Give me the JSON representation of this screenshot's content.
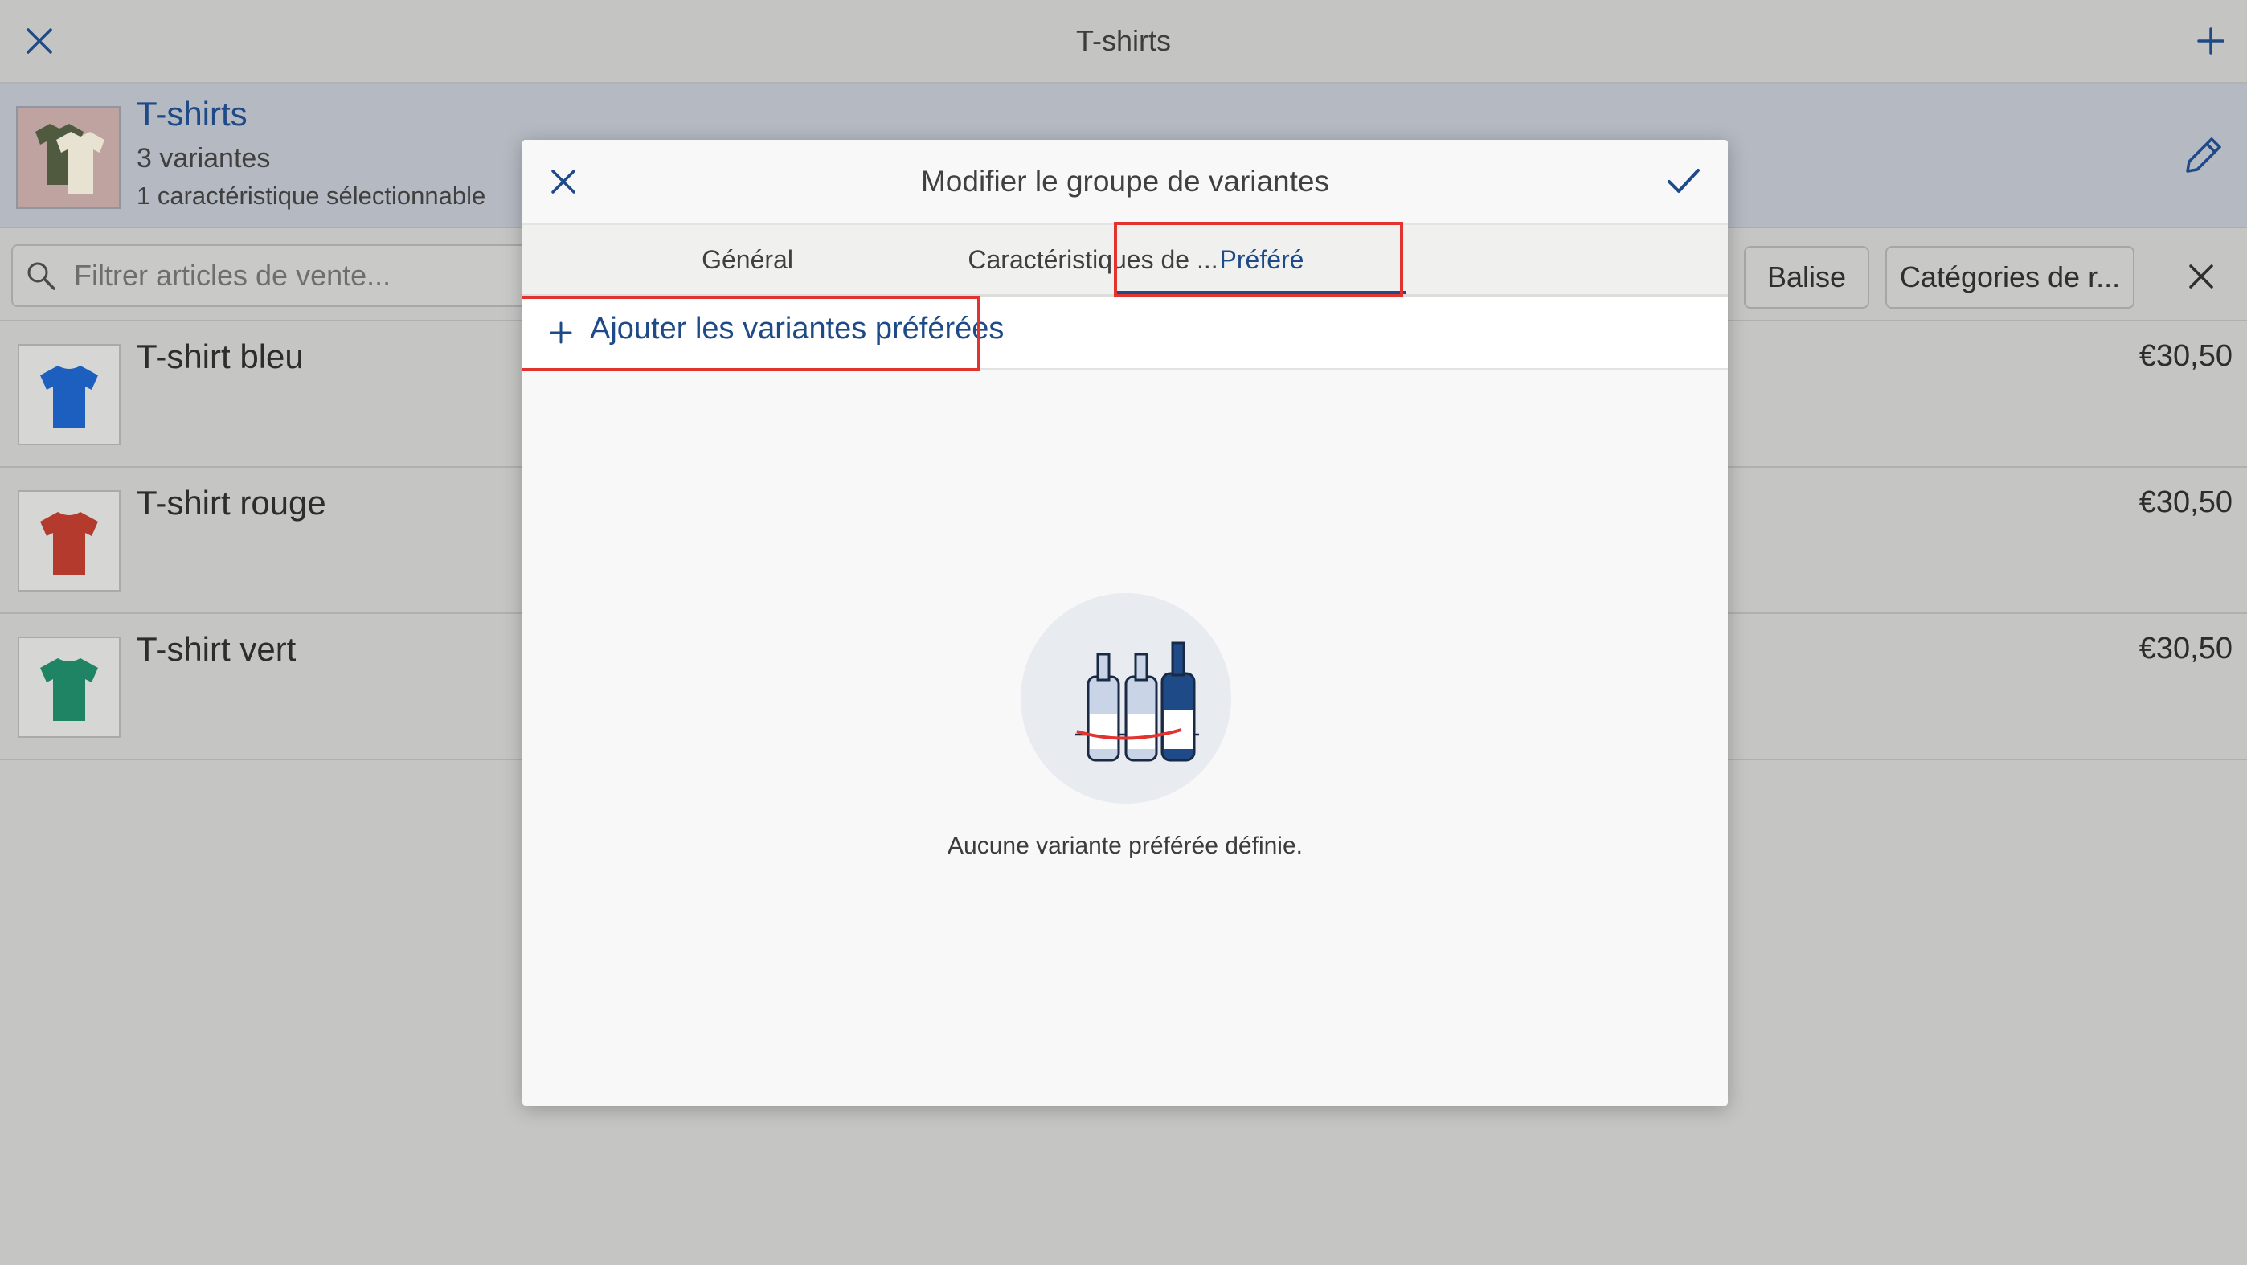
{
  "topbar": {
    "title": "T-shirts",
    "close_icon": "close-icon",
    "add_icon": "plus-icon"
  },
  "group": {
    "title": "T-shirts",
    "variants": "3 variantes",
    "characteristics": "1 caractéristique sélectionnable",
    "edit_icon": "pencil-icon"
  },
  "filter": {
    "placeholder": "Filtrer articles de vente...",
    "chips": [
      "Balise",
      "Catégories de r..."
    ],
    "clear_icon": "close-icon"
  },
  "products": [
    {
      "name": "T-shirt bleu",
      "price": "€30,50",
      "color": "#1d5fbf"
    },
    {
      "name": "T-shirt rouge",
      "price": "€30,50",
      "color": "#b33a2c"
    },
    {
      "name": "T-shirt vert",
      "price": "€30,50",
      "color": "#1e8463"
    }
  ],
  "modal": {
    "title": "Modifier le groupe de variantes",
    "tabs": [
      "Général",
      "Caractéristiques de ...",
      "Préféré"
    ],
    "active_tab": "Préféré",
    "add_label": "Ajouter les variantes préférées",
    "empty_text": "Aucune variante préférée définie."
  },
  "colors": {
    "accent": "#1e4a87",
    "highlight": "#e2332f"
  }
}
